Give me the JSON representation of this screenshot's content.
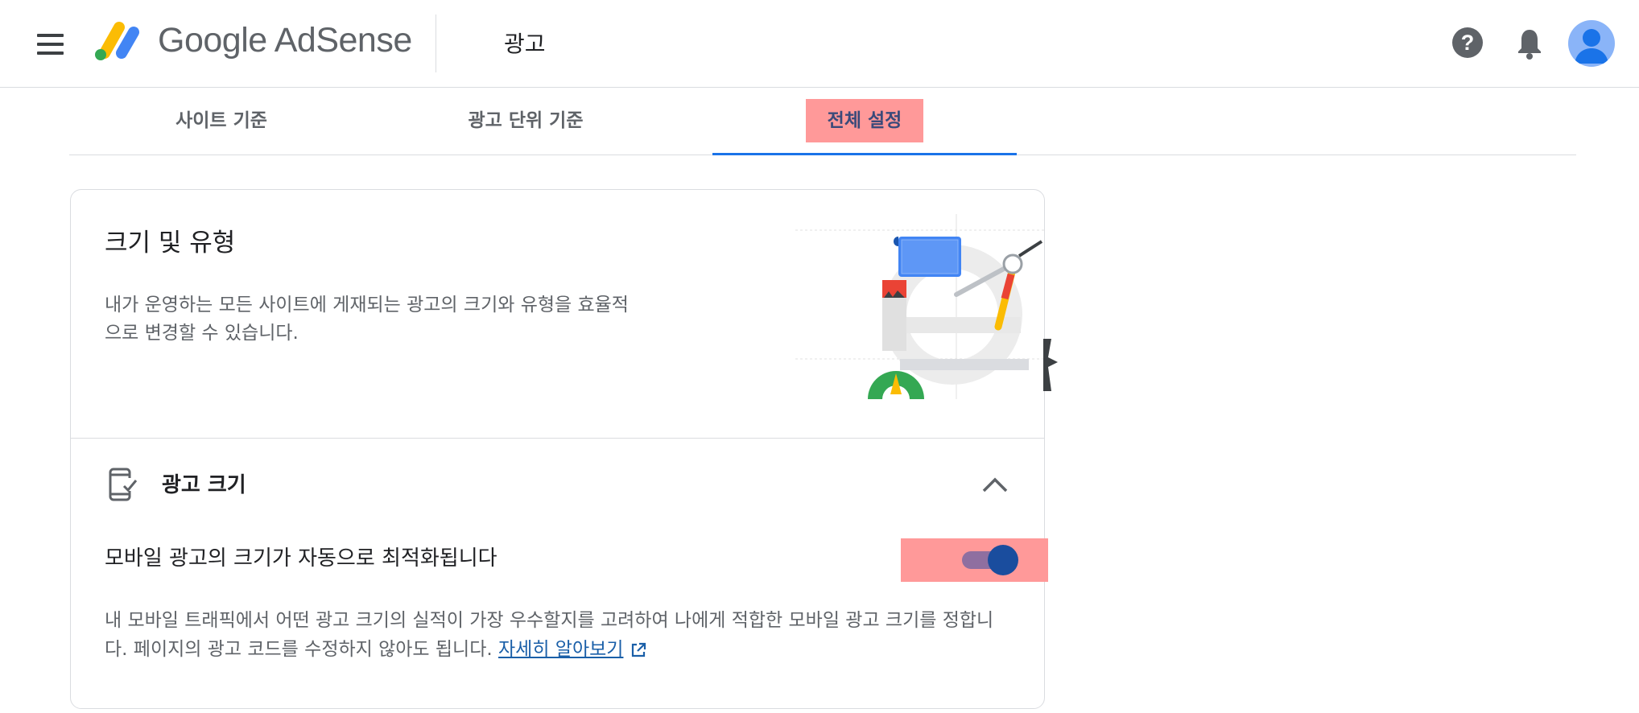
{
  "header": {
    "menu_icon": "hamburger-menu-icon",
    "brand": "Google AdSense",
    "page_title": "광고",
    "help_icon": "help-icon",
    "bell_icon": "notifications-bell-icon",
    "avatar_icon": "account-avatar-icon"
  },
  "tabs": [
    {
      "label": "사이트 기준"
    },
    {
      "label": "광고 단위 기준"
    },
    {
      "label": "전체 설정",
      "selected": true
    }
  ],
  "card": {
    "title": "크기 및 유형",
    "description": "내가 운영하는 모든 사이트에 게재되는 광고의 크기와 유형을 효율적으로 변경할 수 있습니다.",
    "illustration": "design-tools-illustration",
    "section": {
      "icon": "mobile-check-icon",
      "title": "광고 크기",
      "expanded": true,
      "setting_label": "모바일 광고의 크기가 자동으로 최적화됩니다",
      "toggle_on": true,
      "description": "내 모바일 트래픽에서 어떤 광고 크기의 실적이 가장 우수할지를 고려하여 나에게 적합한 모바일 광고 크기를 정합니다. 페이지의 광고 코드를 수정하지 않아도 됩니다.",
      "learn_more": "자세히 알아보기",
      "external_icon": "open-in-new-icon"
    }
  },
  "colors": {
    "accent": "#1a73e8",
    "highlight": "#ff9999",
    "toggle_knob": "#1a4d9e"
  }
}
